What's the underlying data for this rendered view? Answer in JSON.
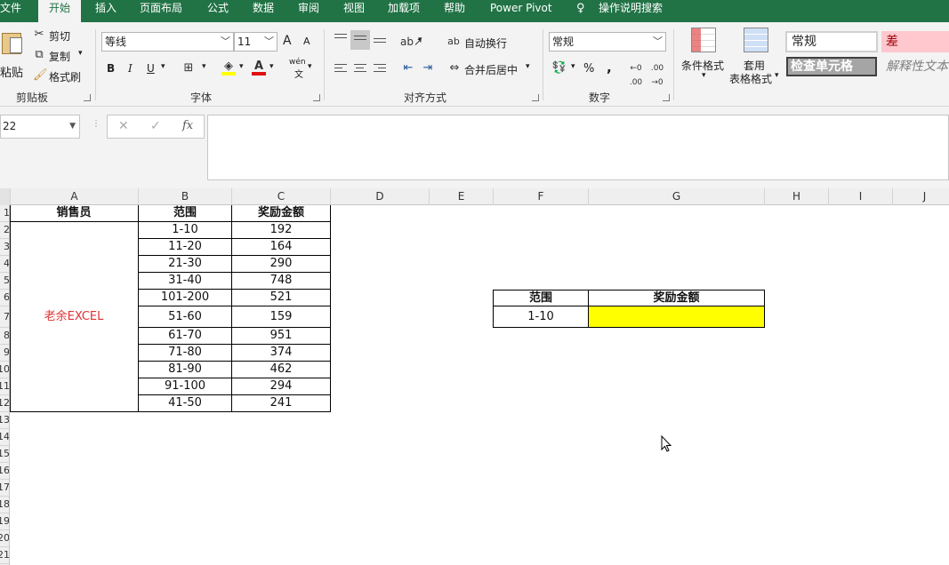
{
  "menu": {
    "tabs": [
      "文件",
      "开始",
      "插入",
      "页面布局",
      "公式",
      "数据",
      "审阅",
      "视图",
      "加载项",
      "帮助",
      "Power Pivot",
      "操作说明搜索"
    ]
  },
  "ribbon": {
    "clipboard": {
      "paste": "粘贴",
      "cut": "剪切",
      "copy": "复制",
      "format_painter": "格式刷",
      "label": "剪贴板"
    },
    "font": {
      "name": "等线",
      "size": "11",
      "label": "字体",
      "bold": "B",
      "italic": "I",
      "underline": "U",
      "grow": "A",
      "shrink": "A",
      "phonetic": "wén"
    },
    "alignment": {
      "wrap": "自动换行",
      "merge": "合并后居中",
      "label": "对齐方式"
    },
    "number": {
      "format": "常规",
      "label": "数字",
      "percent": "%",
      "comma": ","
    },
    "styles": {
      "conditional": "条件格式",
      "table_1": "套用",
      "table_2": "表格格式",
      "normal": "常规",
      "bad": "差",
      "check": "检查单元格",
      "explanatory": "解释性文本"
    }
  },
  "formula_bar": {
    "name_box": "22",
    "cancel": "✕",
    "enter": "✓",
    "fx": "fx",
    "content": ""
  },
  "columns": [
    "A",
    "B",
    "C",
    "D",
    "E",
    "F",
    "G",
    "H",
    "I",
    "J"
  ],
  "rows": [
    "1",
    "2",
    "3",
    "4",
    "5",
    "6",
    "7",
    "8",
    "9",
    "10",
    "11",
    "12",
    "13",
    "14",
    "15",
    "16",
    "17",
    "18",
    "19",
    "20",
    "21"
  ],
  "table": {
    "headers": [
      "销售员",
      "范围",
      "奖励金额"
    ],
    "salesperson": "老余EXCEL",
    "rows": [
      [
        "1-10",
        "192"
      ],
      [
        "11-20",
        "164"
      ],
      [
        "21-30",
        "290"
      ],
      [
        "31-40",
        "748"
      ],
      [
        "101-200",
        "521"
      ],
      [
        "51-60",
        "159"
      ],
      [
        "61-70",
        "951"
      ],
      [
        "71-80",
        "374"
      ],
      [
        "81-90",
        "462"
      ],
      [
        "91-100",
        "294"
      ],
      [
        "41-50",
        "241"
      ]
    ]
  },
  "lookup": {
    "header_range": "范围",
    "header_amount": "奖励金额",
    "range_value": "1-10",
    "amount_value": "",
    "highlight": "#ffff00"
  },
  "colors": {
    "excel_green": "#217346",
    "salesperson_red": "#e03030",
    "bad_bg": "#ffc7ce",
    "bad_text": "#9c0006"
  }
}
